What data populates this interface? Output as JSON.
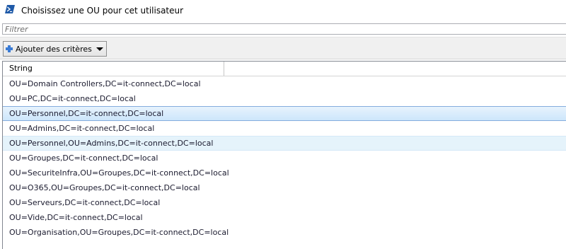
{
  "window": {
    "title": "Choisissez une OU pour cet utilisateur",
    "icon": "powershell-icon",
    "accent": "#0f4c9c"
  },
  "filter": {
    "placeholder": "Filtrer",
    "value": ""
  },
  "toolbar": {
    "add_criteria_label": "Ajouter des critères",
    "add_icon": "plus-icon",
    "dropdown_icon": "caret-down-icon"
  },
  "grid": {
    "columns": [
      "String"
    ],
    "selected_index": 2,
    "hover_index": 4,
    "rows": [
      "OU=Domain Controllers,DC=it-connect,DC=local",
      "OU=PC,DC=it-connect,DC=local",
      "OU=Personnel,DC=it-connect,DC=local",
      "OU=Admins,DC=it-connect,DC=local",
      "OU=Personnel,OU=Admins,DC=it-connect,DC=local",
      "OU=Groupes,DC=it-connect,DC=local",
      "OU=SecuriteInfra,OU=Groupes,DC=it-connect,DC=local",
      "OU=O365,OU=Groupes,DC=it-connect,DC=local",
      "OU=Serveurs,DC=it-connect,DC=local",
      "OU=Vide,DC=it-connect,DC=local",
      "OU=Organisation,OU=Groupes,DC=it-connect,DC=local"
    ]
  }
}
